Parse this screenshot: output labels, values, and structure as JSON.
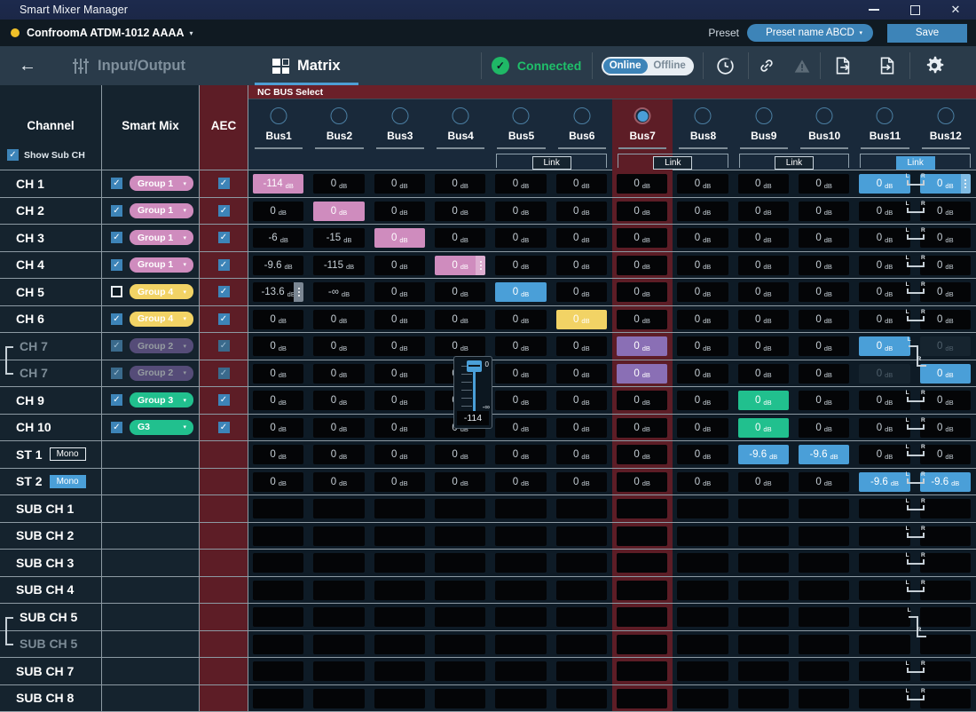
{
  "window": {
    "title": "Smart Mixer Manager",
    "minimize": "minimize-icon",
    "maximize": "maximize-icon",
    "close": "close-icon"
  },
  "device_bar": {
    "device_name": "ConfroomA ATDM-1012 AAAA",
    "device_caret": "▾",
    "status_dot_color": "#f0c029",
    "preset_label": "Preset",
    "preset_value": "Preset name ABCD",
    "preset_caret": "▾",
    "save_label": "Save"
  },
  "nav": {
    "back": "←",
    "tabs": [
      {
        "label": "Input/Output",
        "icon": "sliders-icon",
        "active": false
      },
      {
        "label": "Matrix",
        "icon": "matrix-grid-icon",
        "active": true
      }
    ],
    "connection": {
      "label": "Connected",
      "icon": "check-circle-icon",
      "color": "#1fc06a"
    },
    "mode_toggle": {
      "on_label": "Online",
      "off_label": "Offline",
      "selected": "Online"
    },
    "icons": [
      {
        "name": "refresh-icon",
        "glyph": "⟳"
      },
      {
        "name": "link-icon",
        "glyph": "⚭"
      },
      {
        "name": "warning-icon",
        "glyph": "⚠"
      },
      {
        "name": "export-file-icon",
        "glyph": "⮕"
      },
      {
        "name": "import-file-icon",
        "glyph": "⬅"
      },
      {
        "name": "settings-gear-icon",
        "glyph": "⚙"
      }
    ]
  },
  "matrix": {
    "nc_bus_select_label": "NC BUS Select",
    "left_headers": {
      "channel": "Channel",
      "smart_mix": "Smart Mix",
      "aec": "AEC",
      "show_sub_ch": "Show Sub CH",
      "show_sub_ch_checked": true
    },
    "buses": [
      {
        "name": "Bus1",
        "selected": false
      },
      {
        "name": "Bus2",
        "selected": false
      },
      {
        "name": "Bus3",
        "selected": false
      },
      {
        "name": "Bus4",
        "selected": false
      },
      {
        "name": "Bus5",
        "selected": false
      },
      {
        "name": "Bus6",
        "selected": false
      },
      {
        "name": "Bus7",
        "selected": true
      },
      {
        "name": "Bus8",
        "selected": false
      },
      {
        "name": "Bus9",
        "selected": false
      },
      {
        "name": "Bus10",
        "selected": false
      },
      {
        "name": "Bus11",
        "selected": false
      },
      {
        "name": "Bus12",
        "selected": false
      }
    ],
    "link_label": "Link",
    "links": [
      {
        "pair": [
          5,
          6
        ],
        "label": "Link",
        "active": false
      },
      {
        "pair": [
          7,
          8
        ],
        "label": "Link",
        "active": false
      },
      {
        "pair": [
          9,
          10
        ],
        "label": "Link",
        "active": false
      },
      {
        "pair": [
          11,
          12
        ],
        "label": "Link",
        "active": true
      }
    ],
    "unit": "dB",
    "rows": [
      {
        "name": "CH 1",
        "type": "ch",
        "dim": false,
        "pair_top": false,
        "pair_bottom": false,
        "smart_mix": {
          "enabled": true,
          "checked": true,
          "group": "Group 1",
          "color": "#cf8cbe"
        },
        "aec": {
          "enabled": true,
          "checked": true
        },
        "cells": [
          {
            "value": "-114",
            "color": "pink"
          },
          {
            "value": "0",
            "color": "none"
          },
          {
            "value": "0",
            "color": "none"
          },
          {
            "value": "0",
            "color": "none"
          },
          {
            "value": "0",
            "color": "none"
          },
          {
            "value": "0",
            "color": "none"
          },
          {
            "value": "0",
            "color": "none"
          },
          {
            "value": "0",
            "color": "none"
          },
          {
            "value": "0",
            "color": "none"
          },
          {
            "value": "0",
            "color": "none"
          },
          {
            "value": "0",
            "color": "blue"
          },
          {
            "value": "0",
            "color": "blue",
            "menu": true
          }
        ]
      },
      {
        "name": "CH 2",
        "type": "ch",
        "dim": false,
        "smart_mix": {
          "enabled": true,
          "checked": true,
          "group": "Group 1",
          "color": "#cf8cbe"
        },
        "aec": {
          "enabled": true,
          "checked": true
        },
        "cells": [
          {
            "value": "0",
            "color": "none"
          },
          {
            "value": "0",
            "color": "pink"
          },
          {
            "value": "0",
            "color": "none"
          },
          {
            "value": "0",
            "color": "none"
          },
          {
            "value": "0",
            "color": "none"
          },
          {
            "value": "0",
            "color": "none"
          },
          {
            "value": "0",
            "color": "none"
          },
          {
            "value": "0",
            "color": "none"
          },
          {
            "value": "0",
            "color": "none"
          },
          {
            "value": "0",
            "color": "none"
          },
          {
            "value": "0",
            "color": "none"
          },
          {
            "value": "0",
            "color": "none"
          }
        ]
      },
      {
        "name": "CH 3",
        "type": "ch",
        "dim": false,
        "smart_mix": {
          "enabled": true,
          "checked": true,
          "group": "Group 1",
          "color": "#cf8cbe"
        },
        "aec": {
          "enabled": true,
          "checked": true
        },
        "cells": [
          {
            "value": "-6",
            "color": "none"
          },
          {
            "value": "-15",
            "color": "none"
          },
          {
            "value": "0",
            "color": "pink"
          },
          {
            "value": "0",
            "color": "none"
          },
          {
            "value": "0",
            "color": "none"
          },
          {
            "value": "0",
            "color": "none"
          },
          {
            "value": "0",
            "color": "none"
          },
          {
            "value": "0",
            "color": "none"
          },
          {
            "value": "0",
            "color": "none"
          },
          {
            "value": "0",
            "color": "none"
          },
          {
            "value": "0",
            "color": "none"
          },
          {
            "value": "0",
            "color": "none"
          }
        ]
      },
      {
        "name": "CH 4",
        "type": "ch",
        "dim": false,
        "smart_mix": {
          "enabled": true,
          "checked": true,
          "group": "Group 1",
          "color": "#cf8cbe"
        },
        "aec": {
          "enabled": true,
          "checked": true
        },
        "cells": [
          {
            "value": "-9.6",
            "color": "none"
          },
          {
            "value": "-115",
            "color": "none"
          },
          {
            "value": "0",
            "color": "none"
          },
          {
            "value": "0",
            "color": "pink",
            "menu": true
          },
          {
            "value": "0",
            "color": "none"
          },
          {
            "value": "0",
            "color": "none"
          },
          {
            "value": "0",
            "color": "none"
          },
          {
            "value": "0",
            "color": "none"
          },
          {
            "value": "0",
            "color": "none"
          },
          {
            "value": "0",
            "color": "none"
          },
          {
            "value": "0",
            "color": "none"
          },
          {
            "value": "0",
            "color": "none"
          }
        ]
      },
      {
        "name": "CH 5",
        "type": "ch",
        "dim": false,
        "smart_mix": {
          "enabled": true,
          "checked": false,
          "group": "Group 4",
          "color": "#f2d365"
        },
        "aec": {
          "enabled": true,
          "checked": true
        },
        "cells": [
          {
            "value": "-13.6",
            "color": "none",
            "menu": true,
            "dark_menu": true
          },
          {
            "value": "-∞",
            "color": "none"
          },
          {
            "value": "0",
            "color": "none"
          },
          {
            "value": "0",
            "color": "none"
          },
          {
            "value": "0",
            "color": "blue"
          },
          {
            "value": "0",
            "color": "none"
          },
          {
            "value": "0",
            "color": "none"
          },
          {
            "value": "0",
            "color": "none"
          },
          {
            "value": "0",
            "color": "none"
          },
          {
            "value": "0",
            "color": "none"
          },
          {
            "value": "0",
            "color": "none"
          },
          {
            "value": "0",
            "color": "none"
          }
        ]
      },
      {
        "name": "CH 6",
        "type": "ch",
        "dim": false,
        "smart_mix": {
          "enabled": true,
          "checked": true,
          "group": "Group 4",
          "color": "#f2d365"
        },
        "aec": {
          "enabled": true,
          "checked": true
        },
        "cells": [
          {
            "value": "0",
            "color": "none"
          },
          {
            "value": "0",
            "color": "none"
          },
          {
            "value": "0",
            "color": "none"
          },
          {
            "value": "0",
            "color": "none"
          },
          {
            "value": "0",
            "color": "none"
          },
          {
            "value": "0",
            "color": "yellow"
          },
          {
            "value": "0",
            "color": "none"
          },
          {
            "value": "0",
            "color": "none"
          },
          {
            "value": "0",
            "color": "none"
          },
          {
            "value": "0",
            "color": "none"
          },
          {
            "value": "0",
            "color": "none"
          },
          {
            "value": "0",
            "color": "none"
          }
        ]
      },
      {
        "name": "CH 7",
        "type": "ch",
        "dim": true,
        "pair_top": true,
        "smart_mix": {
          "enabled": false,
          "checked": true,
          "group": "Group 2",
          "color": "#8a6fb5"
        },
        "aec": {
          "enabled": false,
          "checked": true
        },
        "cells": [
          {
            "value": "0",
            "color": "none"
          },
          {
            "value": "0",
            "color": "none"
          },
          {
            "value": "0",
            "color": "none"
          },
          {
            "value": "0",
            "color": "none"
          },
          {
            "value": "0",
            "color": "none"
          },
          {
            "value": "0",
            "color": "none"
          },
          {
            "value": "0",
            "color": "purple"
          },
          {
            "value": "0",
            "color": "none"
          },
          {
            "value": "0",
            "color": "none"
          },
          {
            "value": "0",
            "color": "none"
          },
          {
            "value": "0",
            "color": "blue"
          },
          {
            "value": "0",
            "color": "ghost"
          }
        ]
      },
      {
        "name": "CH 7",
        "type": "ch",
        "dim": true,
        "pair_bottom": true,
        "smart_mix": {
          "enabled": false,
          "checked": true,
          "group": "Group 2",
          "color": "#8a6fb5"
        },
        "aec": {
          "enabled": false,
          "checked": true
        },
        "cells": [
          {
            "value": "0",
            "color": "none"
          },
          {
            "value": "0",
            "color": "none"
          },
          {
            "value": "0",
            "color": "none"
          },
          {
            "value": "0",
            "color": "none"
          },
          {
            "value": "0",
            "color": "none"
          },
          {
            "value": "0",
            "color": "none"
          },
          {
            "value": "0",
            "color": "purple"
          },
          {
            "value": "0",
            "color": "none"
          },
          {
            "value": "0",
            "color": "none"
          },
          {
            "value": "0",
            "color": "none"
          },
          {
            "value": "0",
            "color": "ghost"
          },
          {
            "value": "0",
            "color": "blue"
          }
        ]
      },
      {
        "name": "CH 9",
        "type": "ch",
        "dim": false,
        "smart_mix": {
          "enabled": true,
          "checked": true,
          "group": "Group 3",
          "color": "#21c08e"
        },
        "aec": {
          "enabled": true,
          "checked": true
        },
        "cells": [
          {
            "value": "0",
            "color": "none"
          },
          {
            "value": "0",
            "color": "none"
          },
          {
            "value": "0",
            "color": "none"
          },
          {
            "value": "0",
            "color": "none"
          },
          {
            "value": "0",
            "color": "none"
          },
          {
            "value": "0",
            "color": "none"
          },
          {
            "value": "0",
            "color": "none"
          },
          {
            "value": "0",
            "color": "none"
          },
          {
            "value": "0",
            "color": "green"
          },
          {
            "value": "0",
            "color": "none"
          },
          {
            "value": "0",
            "color": "none"
          },
          {
            "value": "0",
            "color": "none"
          }
        ]
      },
      {
        "name": "CH 10",
        "type": "ch",
        "dim": false,
        "smart_mix": {
          "enabled": true,
          "checked": true,
          "group": "G3",
          "color": "#21c08e"
        },
        "aec": {
          "enabled": true,
          "checked": true
        },
        "cells": [
          {
            "value": "0",
            "color": "none"
          },
          {
            "value": "0",
            "color": "none"
          },
          {
            "value": "0",
            "color": "none"
          },
          {
            "value": "0",
            "color": "none"
          },
          {
            "value": "0",
            "color": "none"
          },
          {
            "value": "0",
            "color": "none"
          },
          {
            "value": "0",
            "color": "none"
          },
          {
            "value": "0",
            "color": "none"
          },
          {
            "value": "0",
            "color": "green"
          },
          {
            "value": "0",
            "color": "none"
          },
          {
            "value": "0",
            "color": "none"
          },
          {
            "value": "0",
            "color": "none"
          }
        ]
      },
      {
        "name": "ST 1",
        "type": "st",
        "dim": false,
        "badge": "Mono",
        "badge_on": false,
        "smart_mix": null,
        "aec": null,
        "cells": [
          {
            "value": "0",
            "color": "none"
          },
          {
            "value": "0",
            "color": "none"
          },
          {
            "value": "0",
            "color": "none"
          },
          {
            "value": "0",
            "color": "none"
          },
          {
            "value": "0",
            "color": "none"
          },
          {
            "value": "0",
            "color": "none"
          },
          {
            "value": "0",
            "color": "none"
          },
          {
            "value": "0",
            "color": "none"
          },
          {
            "value": "-9.6",
            "color": "blue"
          },
          {
            "value": "-9.6",
            "color": "blue"
          },
          {
            "value": "0",
            "color": "none"
          },
          {
            "value": "0",
            "color": "none"
          }
        ]
      },
      {
        "name": "ST 2",
        "type": "st",
        "dim": false,
        "badge": "Mono",
        "badge_on": true,
        "smart_mix": null,
        "aec": null,
        "cells": [
          {
            "value": "0",
            "color": "none"
          },
          {
            "value": "0",
            "color": "none"
          },
          {
            "value": "0",
            "color": "none"
          },
          {
            "value": "0",
            "color": "none"
          },
          {
            "value": "0",
            "color": "none"
          },
          {
            "value": "0",
            "color": "none"
          },
          {
            "value": "0",
            "color": "none"
          },
          {
            "value": "0",
            "color": "none"
          },
          {
            "value": "0",
            "color": "none"
          },
          {
            "value": "0",
            "color": "none"
          },
          {
            "value": "-9.6",
            "color": "blue"
          },
          {
            "value": "-9.6",
            "color": "blue"
          }
        ]
      },
      {
        "name": "SUB CH 1",
        "type": "sub",
        "dim": false,
        "smart_mix": null,
        "aec": null,
        "cells": []
      },
      {
        "name": "SUB CH 2",
        "type": "sub",
        "dim": false,
        "smart_mix": null,
        "aec": null,
        "cells": []
      },
      {
        "name": "SUB CH 3",
        "type": "sub",
        "dim": false,
        "smart_mix": null,
        "aec": null,
        "cells": []
      },
      {
        "name": "SUB CH 4",
        "type": "sub",
        "dim": false,
        "smart_mix": null,
        "aec": null,
        "cells": []
      },
      {
        "name": "SUB CH 5",
        "type": "sub",
        "dim": false,
        "pair_top": true,
        "smart_mix": null,
        "aec": null,
        "cells": []
      },
      {
        "name": "SUB CH 5",
        "type": "sub",
        "dim": true,
        "pair_bottom": true,
        "smart_mix": null,
        "aec": null,
        "cells": []
      },
      {
        "name": "SUB CH 7",
        "type": "sub",
        "dim": false,
        "smart_mix": null,
        "aec": null,
        "cells": []
      },
      {
        "name": "SUB CH 8",
        "type": "sub",
        "dim": false,
        "smart_mix": null,
        "aec": null,
        "cells": []
      }
    ],
    "slider_popup": {
      "row": 4,
      "column": 4,
      "top_label": "0",
      "bottom_label": "-∞",
      "value": "-114"
    }
  }
}
